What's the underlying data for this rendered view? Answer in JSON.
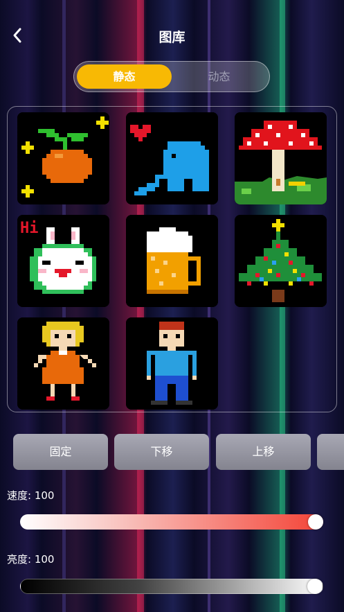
{
  "header": {
    "title": "图库",
    "back_icon": "chevron-left-icon"
  },
  "segment": {
    "active": "静态",
    "inactive": "动态",
    "active_color": "#f8b904"
  },
  "gallery": {
    "items": [
      {
        "name": "orange-sprout",
        "icon": "orange-icon"
      },
      {
        "name": "elephant-heart",
        "icon": "elephant-icon"
      },
      {
        "name": "mushroom",
        "icon": "mushroom-icon"
      },
      {
        "name": "bunny-face",
        "icon": "bunny-icon",
        "text": "Hi"
      },
      {
        "name": "beer-mug",
        "icon": "beer-icon"
      },
      {
        "name": "christmas-tree",
        "icon": "tree-icon"
      },
      {
        "name": "girl",
        "icon": "girl-icon"
      },
      {
        "name": "boy",
        "icon": "boy-icon"
      }
    ]
  },
  "modes": [
    "固定",
    "下移",
    "上移"
  ],
  "speed": {
    "label": "速度: 100",
    "value": 100,
    "max": 100,
    "color": "#f44336"
  },
  "brightness": {
    "label": "亮度: 100",
    "value": 100,
    "max": 100
  }
}
